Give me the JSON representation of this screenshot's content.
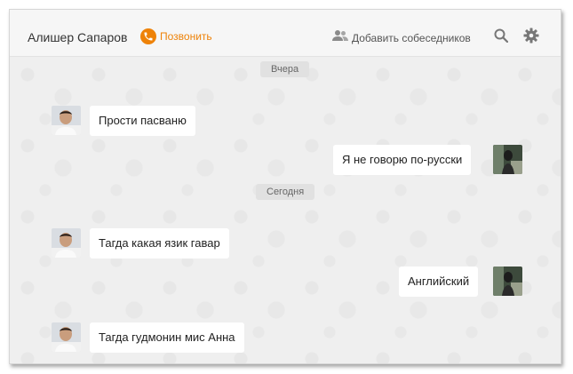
{
  "header": {
    "contact_name": "Алишер Сапаров",
    "call_label": "Позвонить",
    "add_participants_label": "Добавить собеседников"
  },
  "icons": {
    "call": "phone-icon",
    "add_participants": "users-icon",
    "search": "search-icon",
    "settings": "gear-icon"
  },
  "colors": {
    "accent": "#ee8208",
    "background": "#efefef",
    "bubble": "#ffffff"
  },
  "chat": {
    "date_yesterday": "Вчера",
    "date_today": "Сегодня",
    "messages": [
      {
        "side": "incoming",
        "text": "Прости пасваню"
      },
      {
        "side": "outgoing",
        "text": "Я не говорю по-русски"
      },
      {
        "side": "incoming",
        "text": "Тагда какая язик гавар"
      },
      {
        "side": "outgoing",
        "text": "Английский"
      },
      {
        "side": "incoming",
        "text": "Тагда гудмонин мис Анна"
      }
    ]
  }
}
